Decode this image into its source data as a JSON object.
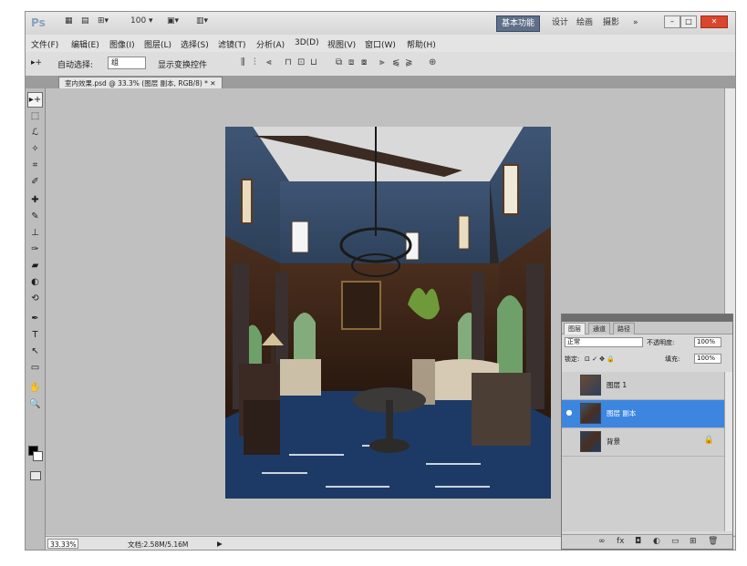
{
  "app": {
    "logo": "Ps",
    "app_buttons": [
      "▦",
      "▤",
      "⊞▾",
      "100 ▾",
      "▣▾",
      "▥▾"
    ],
    "workspaces": [
      {
        "label": "基本功能",
        "active": true
      },
      {
        "label": "设计"
      },
      {
        "label": "绘画"
      },
      {
        "label": "摄影"
      },
      {
        "label": "»"
      }
    ],
    "window_controls": [
      "–",
      "□",
      "✕"
    ]
  },
  "menu": [
    "文件(F)",
    "编辑(E)",
    "图像(I)",
    "图层(L)",
    "选择(S)",
    "滤镜(T)",
    "分析(A)",
    "3D(D)",
    "视图(V)",
    "窗口(W)",
    "帮助(H)"
  ],
  "options": {
    "tool_glyph": "▸+",
    "auto_select_label": "自动选择:",
    "auto_select_value": "组",
    "transform_label": "显示变换控件",
    "align_icons": [
      "⫼",
      "⫶",
      "⫷",
      "⊓",
      "⊡",
      "⊔"
    ],
    "distribute_icons": [
      "⧉",
      "⧈",
      "⧇",
      "⫸",
      "⫹",
      "⫺"
    ],
    "extra_icon": "⊕"
  },
  "document": {
    "tab_title": "室内效果.psd @ 33.3% (图层 副本, RGB/8) * ✕"
  },
  "tools": [
    "▸+",
    "⬚",
    "ℒ",
    "✧",
    "⌗",
    "✐",
    "✚",
    "✎",
    "⊥",
    "✑",
    "▰",
    "◐",
    "⟲",
    "✒",
    "T",
    "↖",
    "▭",
    "✋",
    "🔍"
  ],
  "status": {
    "zoom": "33.33%",
    "doc_size": "文档:2.58M/5.16M",
    "nav_arrow": "▶"
  },
  "layers_panel": {
    "tabs": [
      "图层",
      "通道",
      "路径"
    ],
    "blend_mode": "正常",
    "opacity_label": "不透明度:",
    "opacity_value": "100%",
    "lock_label": "锁定:",
    "lock_icons": "⊡ ✓ ✥ 🔒",
    "fill_label": "填充:",
    "fill_value": "100%",
    "layers": [
      {
        "name": "图层 1",
        "visible": false,
        "selected": false
      },
      {
        "name": "图层 副本",
        "visible": true,
        "selected": true
      },
      {
        "name": "背景",
        "visible": false,
        "selected": false,
        "locked": true
      }
    ],
    "footer_icons": [
      "∞",
      "fx",
      "◘",
      "◐",
      "▭",
      "⊞",
      "🗑"
    ]
  }
}
